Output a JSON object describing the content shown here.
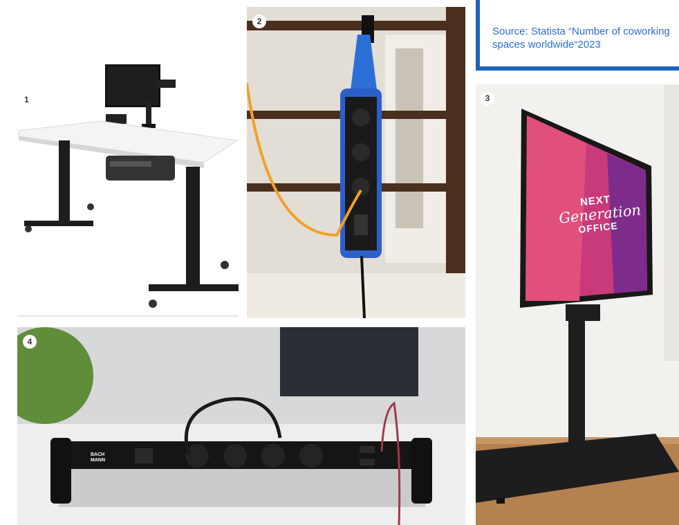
{
  "source": {
    "text": "Source: Statista “Number of coworking spaces worldwide“2023",
    "accent_color": "#1a64b8",
    "text_color": "#2a6fd1"
  },
  "photos": [
    {
      "number": "1",
      "subject": "height-adjustable-desk"
    },
    {
      "number": "2",
      "subject": "hanging-power-strip"
    },
    {
      "number": "3",
      "subject": "display-on-stand"
    },
    {
      "number": "4",
      "subject": "desktop-power-strip"
    }
  ],
  "screen": {
    "line1": "NEXT",
    "line2": "Generation",
    "line3": "OFFICE"
  },
  "brand": {
    "line1": "BACH",
    "line2": "MANN"
  }
}
